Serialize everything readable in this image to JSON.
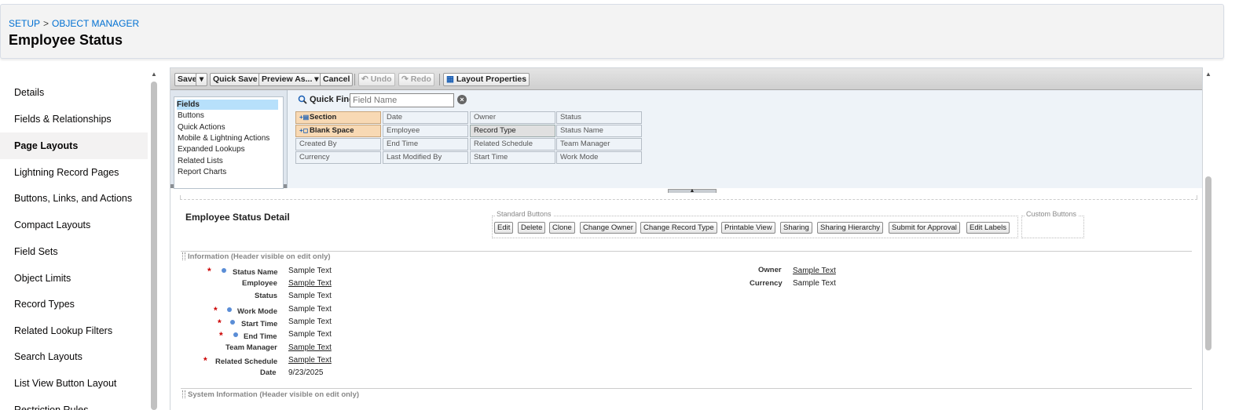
{
  "breadcrumb": {
    "setup": "SETUP",
    "separator": ">",
    "object_manager": "OBJECT MANAGER"
  },
  "page_title": "Employee Status",
  "sidebar": {
    "items": [
      {
        "label": "Details"
      },
      {
        "label": "Fields & Relationships"
      },
      {
        "label": "Page Layouts"
      },
      {
        "label": "Lightning Record Pages"
      },
      {
        "label": "Buttons, Links, and Actions"
      },
      {
        "label": "Compact Layouts"
      },
      {
        "label": "Field Sets"
      },
      {
        "label": "Object Limits"
      },
      {
        "label": "Record Types"
      },
      {
        "label": "Related Lookup Filters"
      },
      {
        "label": "Search Layouts"
      },
      {
        "label": "List View Button Layout"
      },
      {
        "label": "Restriction Rules"
      }
    ],
    "active_item": "Page Layouts"
  },
  "toolbar": {
    "save": "Save",
    "save_menu": "▾",
    "quick_save": "Quick Save",
    "preview_as": "Preview As... ▾",
    "cancel": "Cancel",
    "undo": "Undo",
    "redo": "Redo",
    "layout_properties": "Layout Properties"
  },
  "palette": {
    "categories": [
      "Fields",
      "Buttons",
      "Quick Actions",
      "Mobile & Lightning Actions",
      "Expanded Lookups",
      "Related Lists",
      "Report Charts"
    ],
    "quick_find_label": "Quick Find",
    "quick_find_placeholder": "Field Name",
    "items": [
      [
        "Section",
        "Date",
        "Owner",
        "Status"
      ],
      [
        "Blank Space",
        "Employee",
        "Record Type",
        "Status Name"
      ],
      [
        "Created By",
        "End Time",
        "Related Schedule",
        "Team Manager"
      ],
      [
        "Currency",
        "Last Modified By",
        "Start Time",
        "Work Mode"
      ]
    ]
  },
  "layout": {
    "detail_title": "Employee Status Detail",
    "standard_buttons_label": "Standard Buttons",
    "custom_buttons_label": "Custom Buttons",
    "standard_buttons": [
      "Edit",
      "Delete",
      "Clone",
      "Change Owner",
      "Change Record Type",
      "Printable View",
      "Sharing",
      "Sharing Hierarchy",
      "Submit for Approval",
      "Edit Labels"
    ],
    "info_section": "Information",
    "info_section_note": "(Header visible on edit only)",
    "left_fields": [
      {
        "label": "Status Name",
        "value": "Sample Text"
      },
      {
        "label": "Employee",
        "value": "Sample Text"
      },
      {
        "label": "Status",
        "value": "Sample Text"
      },
      {
        "label": "Work Mode",
        "value": "Sample Text"
      },
      {
        "label": "Start Time",
        "value": "Sample Text"
      },
      {
        "label": "End Time",
        "value": "Sample Text"
      },
      {
        "label": "Team Manager",
        "value": "Sample Text"
      },
      {
        "label": "Related Schedule",
        "value": "Sample Text"
      },
      {
        "label": "Date",
        "value": "9/23/2025"
      }
    ],
    "right_fields": [
      {
        "label": "Owner",
        "value": "Sample Text"
      },
      {
        "label": "Currency",
        "value": "Sample Text"
      }
    ],
    "system_section": "System Information",
    "system_section_note": "(Header visible on edit only)"
  },
  "colors": {
    "accent": "#0070d2",
    "required": "#cc0000",
    "palette_special": "#f8d9b4",
    "selected_category": "#b7e0fb"
  }
}
